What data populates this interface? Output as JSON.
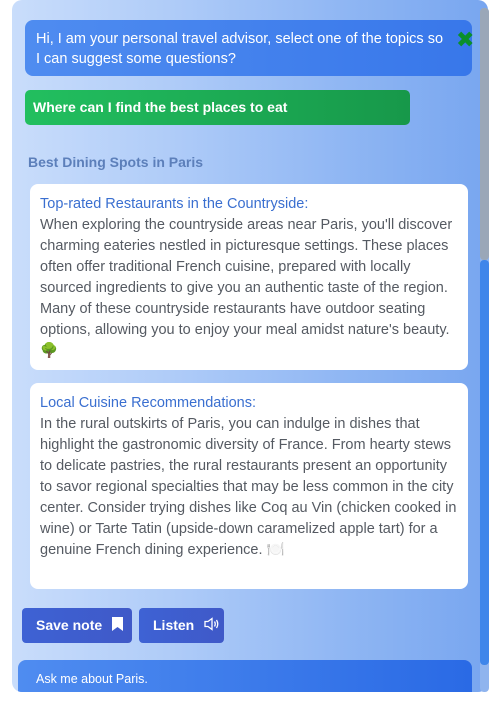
{
  "greeting": "Hi, I am your personal travel advisor, select one of the topics so I can suggest some questions?",
  "close_icon": "✖",
  "question": "Where can I find the best places to eat",
  "section_title": "Best Dining Spots in Paris",
  "cards": [
    {
      "title": "Top-rated Restaurants in the Countryside:",
      "body": "When exploring the countryside areas near Paris, you'll discover charming eateries nestled in picturesque settings. These places often offer traditional French cuisine, prepared with locally sourced ingredients to give you an authentic taste of the region. Many of these countryside restaurants have outdoor seating options, allowing you to enjoy your meal amidst nature's beauty. 🌳"
    },
    {
      "title": "Local Cuisine Recommendations:",
      "body": "In the rural outskirts of Paris, you can indulge in dishes that highlight the gastronomic diversity of France. From hearty stews to delicate pastries, the rural restaurants present an opportunity to savor regional specialties that may be less common in the city center. Consider trying dishes like Coq au Vin (chicken cooked in wine) or Tarte Tatin (upside-down caramelized apple tart) for a genuine French dining experience. 🍽️"
    }
  ],
  "buttons": {
    "save_label": "Save note",
    "listen_label": "Listen"
  },
  "icons": {
    "save": "bookmark-icon",
    "listen": "speaker-icon",
    "close": "close-icon"
  },
  "input_placeholder": "Ask me about Paris.",
  "colors": {
    "accent_blue": "#3877ea",
    "question_green": "#1fae56",
    "close_green": "#0a8f2a",
    "card_title": "#3a6fd0"
  }
}
